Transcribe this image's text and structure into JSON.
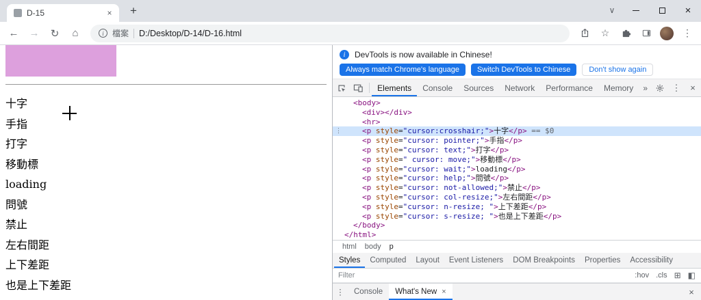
{
  "colors": {
    "accent": "#1a73e8",
    "selection": "#cfe4fc",
    "swatch": "#dda0dd",
    "tag": "#881280",
    "attr_name": "#994500",
    "attr_value": "#1a1aa6"
  },
  "icons": {
    "back": "←",
    "forward": "→",
    "reload": "↻",
    "home": "⌂",
    "info": "i",
    "star": "☆",
    "menu": "⋮",
    "close": "×",
    "new_tab": "+",
    "tab_search": "∨",
    "more_tabs": "»",
    "grid": "⊞",
    "dock": "◧",
    "gutter": "⋮"
  },
  "window": {
    "tab_title": "D-15"
  },
  "toolbar": {
    "scheme_label": "檔案",
    "url": "D:/Desktop/D-14/D-16.html"
  },
  "page": {
    "items": [
      {
        "label": "十字"
      },
      {
        "label": "手指"
      },
      {
        "label": "打字"
      },
      {
        "label": "移動標"
      },
      {
        "label": "loading"
      },
      {
        "label": "問號"
      },
      {
        "label": "禁止"
      },
      {
        "label": "左右間距"
      },
      {
        "label": "上下差距"
      },
      {
        "label": "也是上下差距"
      }
    ]
  },
  "devtools": {
    "infobar": {
      "message": "DevTools is now available in Chinese!",
      "buttons": [
        {
          "label": "Always match Chrome's language",
          "variant": "primary"
        },
        {
          "label": "Switch DevTools to Chinese",
          "variant": "primary"
        },
        {
          "label": "Don't show again",
          "variant": "secondary"
        }
      ]
    },
    "panel_tabs": [
      {
        "label": "Elements",
        "selected": true
      },
      {
        "label": "Console"
      },
      {
        "label": "Sources"
      },
      {
        "label": "Network"
      },
      {
        "label": "Performance"
      },
      {
        "label": "Memory"
      }
    ],
    "tree": [
      {
        "indent": 1,
        "segs": [
          {
            "c": "g",
            "t": "<body>"
          }
        ]
      },
      {
        "indent": 2,
        "segs": [
          {
            "c": "g",
            "t": "<div></div>"
          }
        ]
      },
      {
        "indent": 2,
        "segs": [
          {
            "c": "g",
            "t": "<hr>"
          }
        ]
      },
      {
        "indent": 2,
        "selected": true,
        "segs": [
          {
            "c": "g",
            "t": "<p "
          },
          {
            "c": "a",
            "t": "style"
          },
          {
            "c": "p",
            "t": "="
          },
          {
            "c": "v",
            "t": "\"cursor:crosshair;\""
          },
          {
            "c": "g",
            "t": ">"
          },
          {
            "c": "t",
            "t": "十字"
          },
          {
            "c": "g",
            "t": "</p>"
          },
          {
            "c": "m",
            "t": " == $0"
          }
        ]
      },
      {
        "indent": 2,
        "segs": [
          {
            "c": "g",
            "t": "<p "
          },
          {
            "c": "a",
            "t": "style"
          },
          {
            "c": "p",
            "t": "="
          },
          {
            "c": "v",
            "t": "\"cursor: pointer;\""
          },
          {
            "c": "g",
            "t": ">"
          },
          {
            "c": "t",
            "t": "手指"
          },
          {
            "c": "g",
            "t": "</p>"
          }
        ]
      },
      {
        "indent": 2,
        "segs": [
          {
            "c": "g",
            "t": "<p "
          },
          {
            "c": "a",
            "t": "style"
          },
          {
            "c": "p",
            "t": "="
          },
          {
            "c": "v",
            "t": "\"cursor: text;\""
          },
          {
            "c": "g",
            "t": ">"
          },
          {
            "c": "t",
            "t": "打字"
          },
          {
            "c": "g",
            "t": "</p>"
          }
        ]
      },
      {
        "indent": 2,
        "segs": [
          {
            "c": "g",
            "t": "<p "
          },
          {
            "c": "a",
            "t": "style"
          },
          {
            "c": "p",
            "t": "="
          },
          {
            "c": "v",
            "t": "\" cursor: move;\""
          },
          {
            "c": "g",
            "t": ">"
          },
          {
            "c": "t",
            "t": "移動標"
          },
          {
            "c": "g",
            "t": "</p>"
          }
        ]
      },
      {
        "indent": 2,
        "segs": [
          {
            "c": "g",
            "t": "<p "
          },
          {
            "c": "a",
            "t": "style"
          },
          {
            "c": "p",
            "t": "="
          },
          {
            "c": "v",
            "t": "\"cursor: wait;\""
          },
          {
            "c": "g",
            "t": ">"
          },
          {
            "c": "t",
            "t": "loading"
          },
          {
            "c": "g",
            "t": "</p>"
          }
        ]
      },
      {
        "indent": 2,
        "segs": [
          {
            "c": "g",
            "t": "<p "
          },
          {
            "c": "a",
            "t": "style"
          },
          {
            "c": "p",
            "t": "="
          },
          {
            "c": "v",
            "t": "\"cursor: help;\""
          },
          {
            "c": "g",
            "t": ">"
          },
          {
            "c": "t",
            "t": "問號"
          },
          {
            "c": "g",
            "t": "</p>"
          }
        ]
      },
      {
        "indent": 2,
        "segs": [
          {
            "c": "g",
            "t": "<p "
          },
          {
            "c": "a",
            "t": "style"
          },
          {
            "c": "p",
            "t": "="
          },
          {
            "c": "v",
            "t": "\"cursor: not-allowed;\""
          },
          {
            "c": "g",
            "t": ">"
          },
          {
            "c": "t",
            "t": "禁止"
          },
          {
            "c": "g",
            "t": "</p>"
          }
        ]
      },
      {
        "indent": 2,
        "segs": [
          {
            "c": "g",
            "t": "<p "
          },
          {
            "c": "a",
            "t": "style"
          },
          {
            "c": "p",
            "t": "="
          },
          {
            "c": "v",
            "t": "\"cursor: col-resize;\""
          },
          {
            "c": "g",
            "t": ">"
          },
          {
            "c": "t",
            "t": "左右間距"
          },
          {
            "c": "g",
            "t": "</p>"
          }
        ]
      },
      {
        "indent": 2,
        "segs": [
          {
            "c": "g",
            "t": "<p "
          },
          {
            "c": "a",
            "t": "style"
          },
          {
            "c": "p",
            "t": "="
          },
          {
            "c": "v",
            "t": "\"cursor: n-resize; \""
          },
          {
            "c": "g",
            "t": ">"
          },
          {
            "c": "t",
            "t": "上下差距"
          },
          {
            "c": "g",
            "t": "</p>"
          }
        ]
      },
      {
        "indent": 2,
        "segs": [
          {
            "c": "g",
            "t": "<p "
          },
          {
            "c": "a",
            "t": "style"
          },
          {
            "c": "p",
            "t": "="
          },
          {
            "c": "v",
            "t": "\"cursor: s-resize; \""
          },
          {
            "c": "g",
            "t": ">"
          },
          {
            "c": "t",
            "t": "也是上下差距"
          },
          {
            "c": "g",
            "t": "</p>"
          }
        ]
      },
      {
        "indent": 1,
        "segs": [
          {
            "c": "g",
            "t": "</body>"
          }
        ]
      },
      {
        "indent": 0,
        "segs": [
          {
            "c": "g",
            "t": "</html>"
          }
        ]
      }
    ],
    "breadcrumb": [
      {
        "label": "html"
      },
      {
        "label": "body"
      },
      {
        "label": "p",
        "current": true
      }
    ],
    "sidebar_tabs": [
      {
        "label": "Styles",
        "selected": true
      },
      {
        "label": "Computed"
      },
      {
        "label": "Layout"
      },
      {
        "label": "Event Listeners"
      },
      {
        "label": "DOM Breakpoints"
      },
      {
        "label": "Properties"
      },
      {
        "label": "Accessibility"
      }
    ],
    "filter": {
      "placeholder": "Filter",
      "toggles": [
        ":hov",
        ".cls"
      ]
    },
    "drawer": {
      "tabs": [
        {
          "label": "Console"
        },
        {
          "label": "What's New",
          "selected": true,
          "closable": true
        }
      ]
    }
  }
}
